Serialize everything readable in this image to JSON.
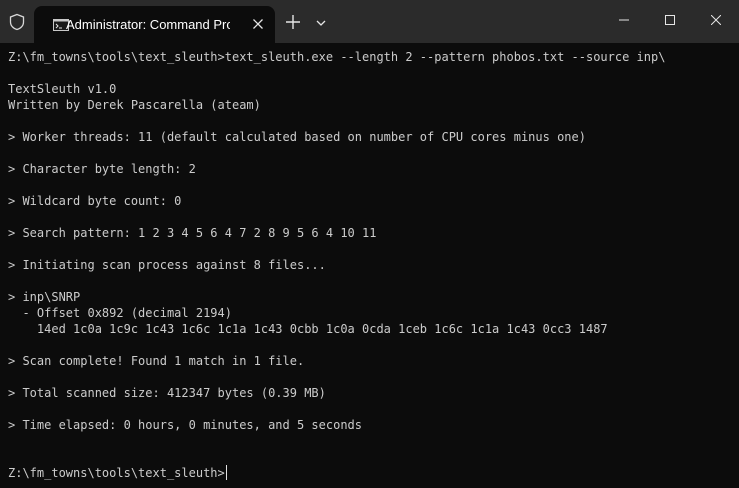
{
  "titlebar": {
    "tab_title": "Administrator: Command Prompt",
    "icons": {
      "shield": "shield-icon",
      "app": "cmd-app-icon",
      "tab_close": "close-icon",
      "new_tab": "plus-icon",
      "dropdown": "chevron-down-icon",
      "minimize": "minimize-icon",
      "maximize": "maximize-icon",
      "close": "close-icon"
    }
  },
  "terminal": {
    "lines": [
      "Z:\\fm_towns\\tools\\text_sleuth>text_sleuth.exe --length 2 --pattern phobos.txt --source inp\\",
      "TextSleuth v1.0",
      "Written by Derek Pascarella (ateam)",
      "> Worker threads: 11 (default calculated based on number of CPU cores minus one)",
      "> Character byte length: 2",
      "> Wildcard byte count: 0",
      "> Search pattern: 1 2 3 4 5 6 4 7 2 8 9 5 6 4 10 11",
      "> Initiating scan process against 8 files...",
      "> inp\\SNRP",
      "  - Offset 0x892 (decimal 2194)",
      "    14ed 1c0a 1c9c 1c43 1c6c 1c1a 1c43 0cbb 1c0a 0cda 1ceb 1c6c 1c1a 1c43 0cc3 1487",
      "> Scan complete! Found 1 match in 1 file.",
      "> Total scanned size: 412347 bytes (0.39 MB)",
      "> Time elapsed: 0 hours, 0 minutes, and 5 seconds",
      "Z:\\fm_towns\\tools\\text_sleuth>"
    ]
  },
  "colors": {
    "terminal_bg": "#0c0c0c",
    "titlebar_bg": "#2b2b2b",
    "text": "#cccccc"
  }
}
